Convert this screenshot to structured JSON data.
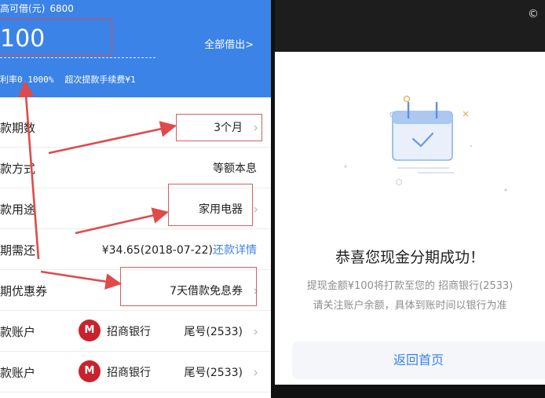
{
  "loan_form": {
    "available_label": "高可借(元)",
    "available_amount": "6800",
    "amount_value": "100",
    "borrow_all": "全部借出>",
    "rate": "利率0.1000%",
    "fee": "超次提款手续费¥1",
    "rows": [
      {
        "label": "款期数",
        "value": "3个月"
      },
      {
        "label": "款方式",
        "value": "等额本息"
      },
      {
        "label": "款用途",
        "value": "家用电器"
      },
      {
        "label": "期需还",
        "value": "¥34.65(2018-07-22)",
        "link": "还款详情"
      },
      {
        "label": "期优惠券",
        "value": "7天借款免息券"
      },
      {
        "label": "款账户",
        "bank_name": "招商银行",
        "tail": "尾号(2533)"
      },
      {
        "label": "款账户",
        "bank_name": "招商银行",
        "tail": "尾号(2533)"
      }
    ],
    "chevron": "›",
    "bank_logo_glyph": "M"
  },
  "success": {
    "copyright_symbol": "©",
    "title": "恭喜您现金分期成功！",
    "line1": "提现金额¥100将打款至您的 招商银行(2533)",
    "line2": "请关注账户余额，具体到账时间以银行为准",
    "back_button": "返回首页"
  },
  "colors": {
    "brand_blue": "#3b83e6",
    "annotation_red": "#e04a4a",
    "bank_red": "#c8232c"
  },
  "icons": [
    "calendar-check-icon",
    "chevron-right-icon",
    "bank-logo-icon"
  ]
}
